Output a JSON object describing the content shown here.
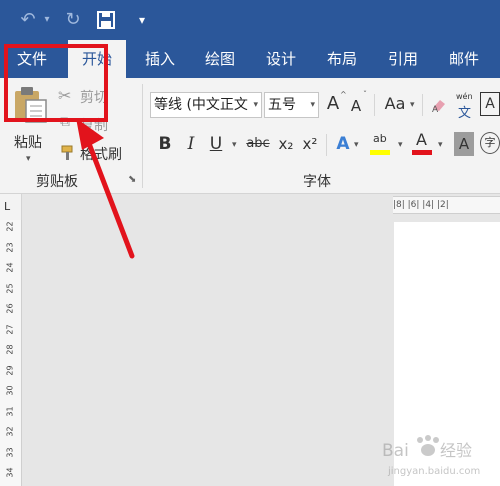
{
  "quick_access": {
    "undo_glyph": "↶",
    "redo_glyph": "↻",
    "save_icon": "save-icon",
    "customize_glyph": "▾"
  },
  "tabs": [
    {
      "label": "文件",
      "active": false
    },
    {
      "label": "开始",
      "active": true
    },
    {
      "label": "插入",
      "active": false
    },
    {
      "label": "绘图",
      "active": false
    },
    {
      "label": "设计",
      "active": false
    },
    {
      "label": "布局",
      "active": false
    },
    {
      "label": "引用",
      "active": false
    },
    {
      "label": "邮件",
      "active": false
    }
  ],
  "clipboard": {
    "paste_label": "粘贴",
    "cut_label": "剪切",
    "copy_label": "复制",
    "format_painter_label": "格式刷",
    "group_label": "剪贴板"
  },
  "font_group": {
    "font_name": "等线 (中文正文",
    "font_size": "五号",
    "grow_label": "A",
    "shrink_label": "A",
    "change_case_label": "Aa",
    "phonetic_label": "wén",
    "phonetic_sub": "文",
    "bold_label": "B",
    "italic_label": "I",
    "underline_label": "U",
    "strike_label": "abc",
    "subscript_label": "x₂",
    "superscript_label": "x²",
    "highlight_label": "ab",
    "font_color_label": "A",
    "shading_label": "A",
    "enclose_label": "字",
    "char_border_label": "A",
    "group_label": "字体"
  },
  "ruler": {
    "h_marks": "|8|  |6|  |4|  |2|",
    "v_marks": [
      "22",
      "23",
      "24",
      "25",
      "26",
      "27",
      "28",
      "29",
      "30",
      "31",
      "32",
      "33",
      "34"
    ]
  },
  "watermark": {
    "brand": "Baidu",
    "cn": "经验",
    "url": "jingyan.baidu.com"
  },
  "colors": {
    "ribbon_blue": "#2b579a",
    "annotation_red": "#e2131c"
  }
}
